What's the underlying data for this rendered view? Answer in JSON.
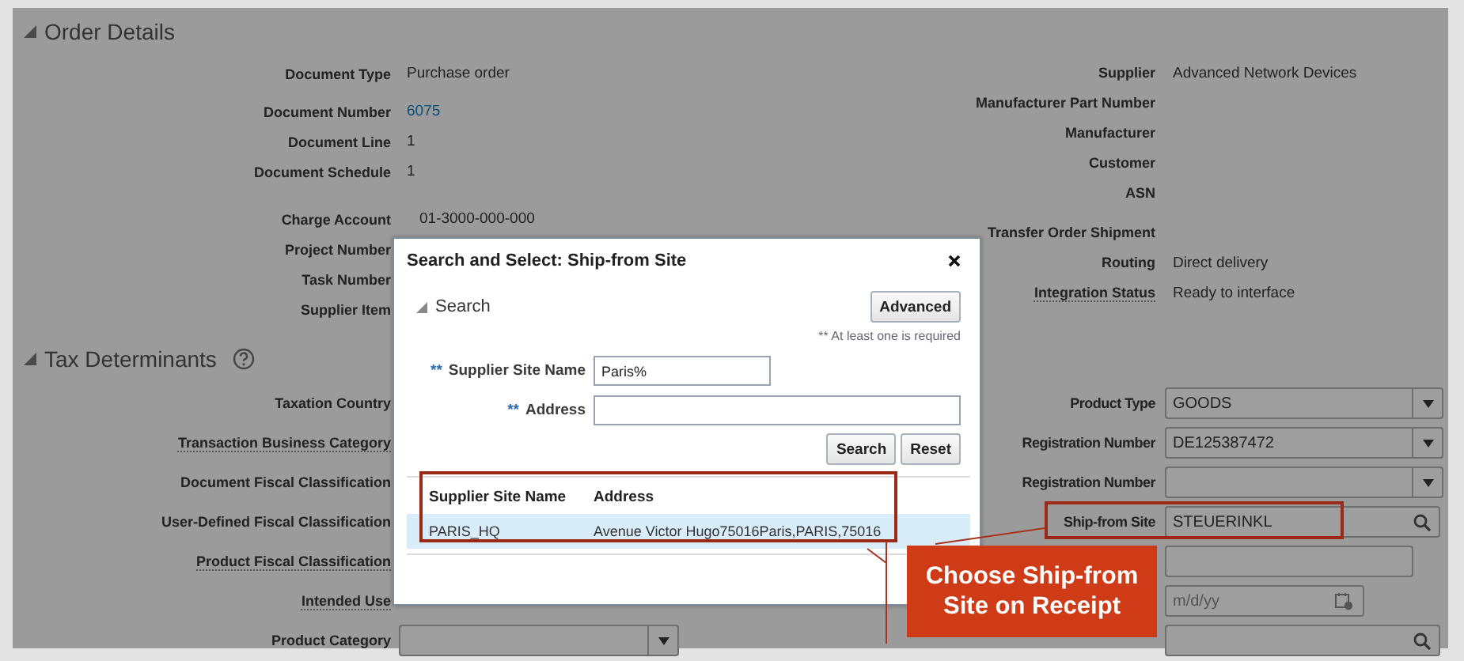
{
  "order_details": {
    "title": "Order Details",
    "left": [
      {
        "label": "Document Type",
        "value": "Purchase order",
        "kind": "text"
      },
      {
        "label": "Document Number",
        "value": "6075",
        "kind": "link"
      },
      {
        "label": "Document Line",
        "value": "1",
        "kind": "text"
      },
      {
        "label": "Document Schedule",
        "value": "1",
        "kind": "text"
      },
      {
        "label": "Charge Account",
        "value": "01-3000-000-000",
        "kind": "text"
      },
      {
        "label": "Project Number"
      },
      {
        "label": "Task Number"
      },
      {
        "label": "Supplier Item"
      }
    ],
    "right": [
      {
        "label": "Supplier",
        "value": "Advanced Network Devices",
        "underlined": false
      },
      {
        "label": "Manufacturer Part Number",
        "underlined": false
      },
      {
        "label": "Manufacturer",
        "underlined": false
      },
      {
        "label": "Customer",
        "underlined": false
      },
      {
        "label": "ASN",
        "underlined": false
      },
      {
        "label": "Transfer Order Shipment",
        "underlined": false
      },
      {
        "label": "Routing",
        "value": "Direct delivery",
        "underlined": false
      },
      {
        "label": "Integration Status",
        "value": "Ready to interface",
        "underlined": true
      }
    ]
  },
  "tax_determinants": {
    "title": "Tax Determinants",
    "left": [
      {
        "label": "Taxation Country",
        "underlined": false
      },
      {
        "label": "Transaction Business Category",
        "underlined": true
      },
      {
        "label": "Document Fiscal Classification",
        "underlined": false
      },
      {
        "label": "User-Defined Fiscal Classification",
        "underlined": false
      },
      {
        "label": "Product Fiscal Classification",
        "underlined": true
      },
      {
        "label": "Intended Use",
        "underlined": true
      },
      {
        "label": "Product Category",
        "underlined": false,
        "field": {
          "kind": "select"
        }
      }
    ],
    "right": [
      {
        "label": "Product Type",
        "underlined": false,
        "field": {
          "kind": "select",
          "value": "GOODS"
        }
      },
      {
        "label": "Registration Number",
        "underlined": false,
        "field": {
          "kind": "select",
          "value": "DE125387472"
        }
      },
      {
        "label": "Registration Number",
        "underlined": false,
        "field": {
          "kind": "select"
        }
      },
      {
        "label": "Ship-from Site",
        "underlined": false,
        "field": {
          "kind": "search",
          "value": "STEUERINKL"
        }
      },
      {
        "field": {
          "kind": "text"
        }
      },
      {
        "field": {
          "kind": "date",
          "placeholder": "m/d/yy"
        }
      },
      {
        "field": {
          "kind": "search"
        }
      }
    ]
  },
  "dialog": {
    "title": "Search and Select: Ship-from Site",
    "search_title": "Search",
    "advanced_button": "Advanced",
    "required_note": "** At least one is required",
    "fields": [
      {
        "marker": "**",
        "label": "Supplier Site Name",
        "value": "Paris%"
      },
      {
        "marker": "**",
        "label": "Address"
      }
    ],
    "buttons": [
      "Search",
      "Reset"
    ],
    "table": {
      "columns": [
        "Supplier Site Name",
        "Address"
      ],
      "rows": [
        {
          "cells": [
            "PARIS_HQ",
            "Avenue Victor Hugo75016Paris,PARIS,75016"
          ],
          "selected": true
        }
      ]
    }
  },
  "callout": {
    "text": "Choose Ship-from Site on Receipt"
  }
}
